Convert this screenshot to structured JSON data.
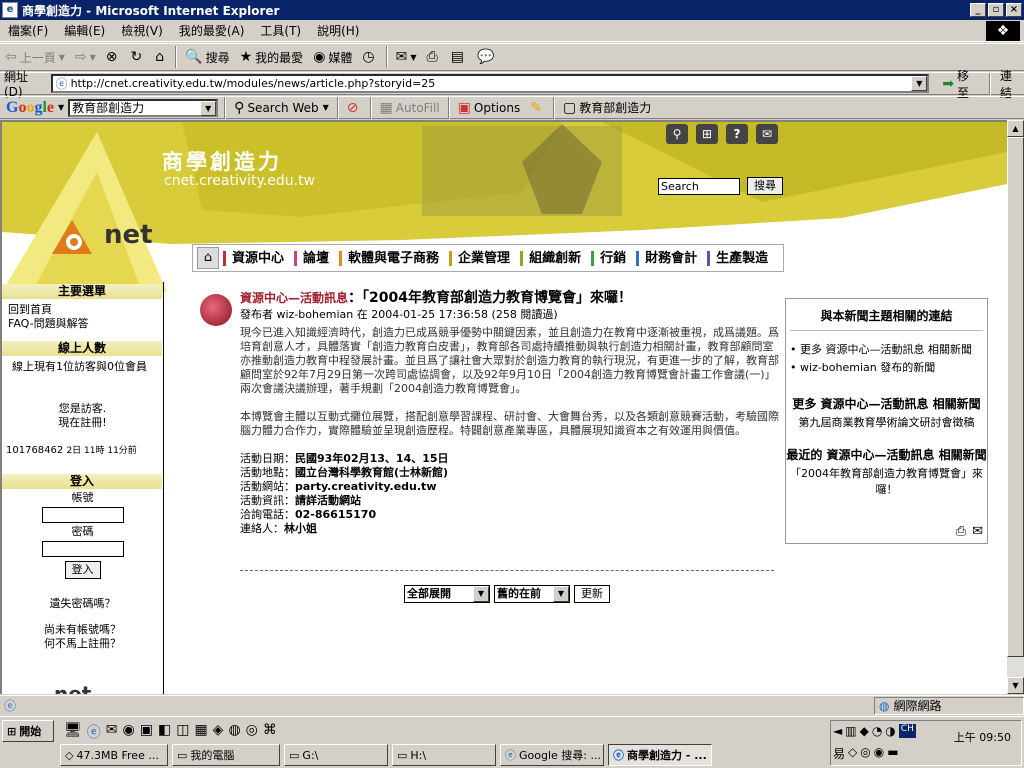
{
  "window": {
    "title": "商學創造力 - Microsoft Internet Explorer",
    "min": "_",
    "max": "▫",
    "close": "×"
  },
  "menu": [
    "檔案(F)",
    "編輯(E)",
    "檢視(V)",
    "我的最愛(A)",
    "工具(T)",
    "說明(H)"
  ],
  "toolbar": {
    "back": "上一頁",
    "search": "搜尋",
    "favorites": "我的最愛",
    "media": "媒體"
  },
  "address": {
    "label": "網址(D)",
    "url": "http://cnet.creativity.edu.tw/modules/news/article.php?storyid=25",
    "go": "移至",
    "links": "連結"
  },
  "googlebar": {
    "logo": [
      "G",
      "o",
      "o",
      "g",
      "l",
      "e"
    ],
    "query": "教育部創造力",
    "search_web": "Search Web",
    "autofill": "AutoFill",
    "options": "Options",
    "term": "教育部創造力"
  },
  "banner": {
    "title": "商學創造力",
    "domain": "cnet.creativity.edu.tw",
    "search_value": "Search",
    "search_btn": "搜尋",
    "logo": "net"
  },
  "nav": [
    "資源中心",
    "論壇",
    "軟體與電子商務",
    "企業管理",
    "組織創新",
    "行銷",
    "財務會計",
    "生產製造"
  ],
  "sidebar": {
    "main_menu": "主要選單",
    "home": "回到首頁",
    "faq": "FAQ-問題與解答",
    "online_head": "線上人數",
    "online_text": "線上現有1位訪客與0位會員",
    "guest": "您是訪客.",
    "register_now": "現在註冊!",
    "counter": "101768462",
    "counter_time": "2日 11時 11分前",
    "login_head": "登入",
    "account": "帳號",
    "password": "密碼",
    "login_btn": "登入",
    "lost_pw": "遺失密碼嗎？",
    "no_account": "尚未有帳號嗎？",
    "register": "何不馬上註冊？"
  },
  "article": {
    "category": "資源中心—活動訊息",
    "title": "：「2004年教育部創造力教育博覽會」來囉！",
    "byline": "發布者 wiz-bohemian 在 2004-01-25 17:36:58 (258 閱讀過)",
    "p1": "現今已進入知識經濟時代，創造力已成爲競爭優勢中關鍵因素，並且創造力在教育中逐漸被重視，成爲議題。爲培育創意人才，具體落實「創造力教育白皮書」，教育部各司處持續推動與執行創造力相關計畫，教育部顧問室亦推動創造力教育中程發展計畫。並且爲了讓社會大眾對於創造力教育的執行現況，有更進一步的了解，教育部顧問室於92年7月29日第一次跨司處協調會，以及92年9月10日「2004創造力教育博覽會計畫工作會議(一)」兩次會議決議辦理，著手規劃「2004創造力教育博覽會」。",
    "p2": "本博覽會主體以互動式攤位展覽，搭配創意學習課程、研討會、大會舞台秀，以及各類創意競賽活動，考驗國際腦力體力合作力，實際體驗並呈現創造歷程。特闢創意產業專區，具體展現知識資本之有效運用與價值。",
    "details": [
      {
        "k": "活動日期：",
        "v": "民國93年02月13、14、15日"
      },
      {
        "k": "活動地點：",
        "v": "國立台灣科學教育館(士林新館)"
      },
      {
        "k": "活動網站：",
        "v": "party.creativity.edu.tw"
      },
      {
        "k": "活動資訊：",
        "v": "請詳活動網站"
      },
      {
        "k": "洽詢電話：",
        "v": "02-86615170"
      },
      {
        "k": "連絡人：",
        "v": "林小姐"
      }
    ],
    "sel1": "全部展開",
    "sel2": "舊的在前",
    "refresh": "更新"
  },
  "related": {
    "head": "與本新聞主題相關的連結",
    "link1": "更多 資源中心—活動訊息 相關新聞",
    "link2": "wiz-bohemian 發布的新聞",
    "more_head": "更多 資源中心—活動訊息 相關新聞",
    "more_item": "第九屆商業教育學術論文研討會徵稿",
    "recent_head": "最近的 資源中心—活動訊息 相關新聞",
    "recent_item": "「2004年教育部創造力教育博覽會」來囉！"
  },
  "status": {
    "zone": "網際網路"
  },
  "taskbar": {
    "start": "開始",
    "tasks": [
      "47.3MB Free ...",
      "我的電腦",
      "G:\\",
      "H:\\",
      "Google 搜尋: ...",
      "商學創造力 - ..."
    ],
    "clock": "上午 09:50",
    "ime": "CH"
  }
}
